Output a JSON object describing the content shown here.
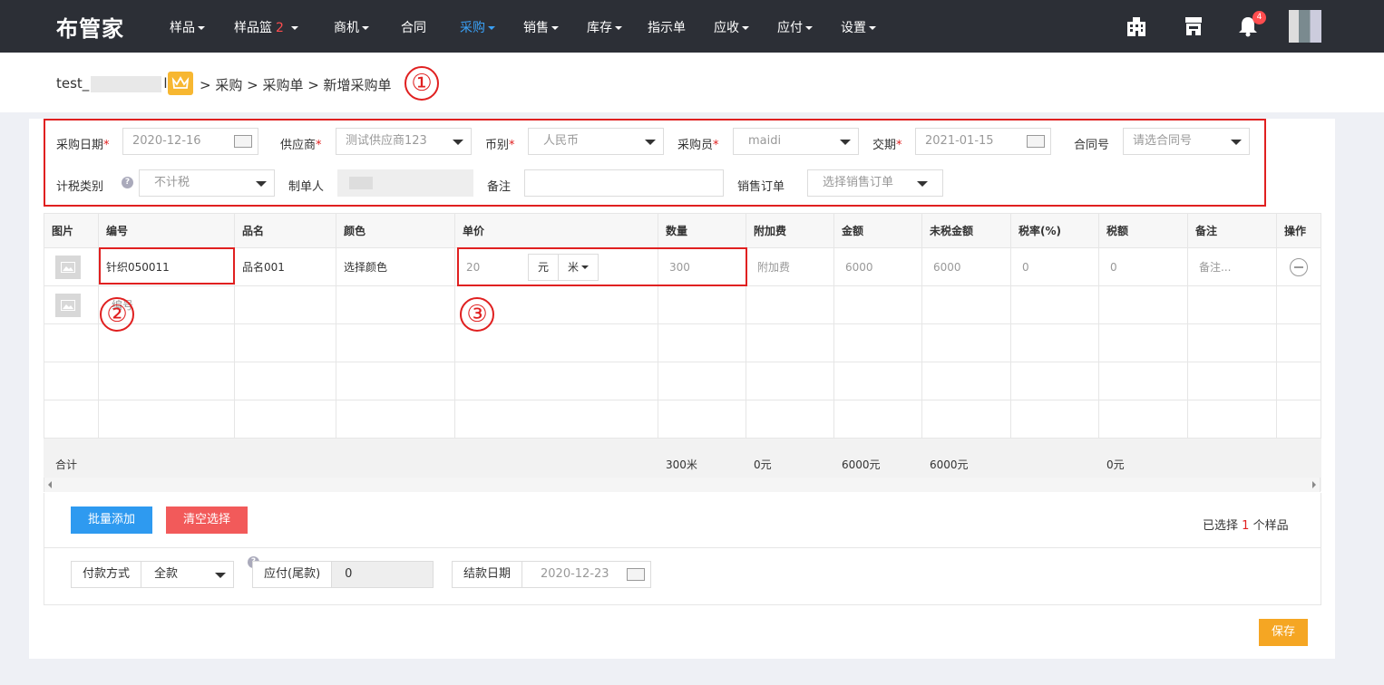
{
  "nav": {
    "logo": "布管家",
    "items": [
      {
        "label": "样品",
        "caret": true
      },
      {
        "label": "样品篮",
        "badge": "2",
        "caret": true
      },
      {
        "label": "商机",
        "caret": true
      },
      {
        "label": "合同",
        "caret": false
      },
      {
        "label": "采购",
        "caret": true,
        "active": true
      },
      {
        "label": "销售",
        "caret": true
      },
      {
        "label": "库存",
        "caret": true
      },
      {
        "label": "指示单",
        "caret": false
      },
      {
        "label": "应收",
        "caret": true
      },
      {
        "label": "应付",
        "caret": true
      },
      {
        "label": "设置",
        "caret": true
      }
    ],
    "notification_count": "4",
    "icons": [
      "building-icon",
      "store-icon",
      "bell-icon"
    ]
  },
  "breadcrumb": {
    "account_prefix": "test_",
    "account_suffix": "l",
    "path": "> 采购 > 采购单 > 新增采购单"
  },
  "annotations": [
    "①",
    "②",
    "③"
  ],
  "form": {
    "purchase_date_label": "采购日期",
    "purchase_date": "2020-12-16",
    "supplier_label": "供应商",
    "supplier": "测试供应商123",
    "currency_label": "币别",
    "currency": "人民币",
    "buyer_label": "采购员",
    "buyer": "maidi",
    "delivery_label": "交期",
    "delivery_date": "2021-01-15",
    "contract_label": "合同号",
    "contract_placeholder": "请选合同号",
    "tax_type_label": "计税类别",
    "tax_type": "不计税",
    "creator_label": "制单人",
    "remark_label": "备注",
    "remark_value": "",
    "sales_order_label": "销售订单",
    "sales_order_placeholder": "选择销售订单",
    "required_mark": "*",
    "help_mark": "?"
  },
  "table": {
    "headers": [
      "图片",
      "编号",
      "品名",
      "颜色",
      "单价",
      "数量",
      "附加费",
      "金额",
      "未税金额",
      "税率(%)",
      "税额",
      "备注",
      "操作"
    ],
    "row1": {
      "code": "针织050011",
      "name": "品名001",
      "color": "选择颜色",
      "price": "20",
      "currency_unit": "元",
      "length_unit": "米",
      "qty": "300",
      "surcharge": "附加费",
      "amount": "6000",
      "untaxed": "6000",
      "tax_rate": "0",
      "tax": "0",
      "remark": "备注..."
    },
    "row2_code_placeholder": "编号",
    "summary": {
      "label": "合计",
      "qty": "300米",
      "surcharge": "0元",
      "amount": "6000元",
      "untaxed": "6000元",
      "tax": "0元"
    }
  },
  "actions": {
    "batch_add": "批量添加",
    "clear": "清空选择",
    "selected_prefix": "已选择",
    "selected_count": "1",
    "selected_suffix": "个样品"
  },
  "payment": {
    "method_label": "付款方式",
    "method": "全款",
    "payable_label": "应付(尾款)",
    "payable": "0",
    "settle_label": "结款日期",
    "settle_date": "2020-12-23"
  },
  "save": "保存",
  "colors": {
    "nav_bg": "#2c2f36",
    "accent": "#3aa0f5",
    "danger": "#e02020",
    "warning": "#f5a623",
    "primary_btn": "#2e9af0",
    "clear_btn": "#f25a5a"
  }
}
